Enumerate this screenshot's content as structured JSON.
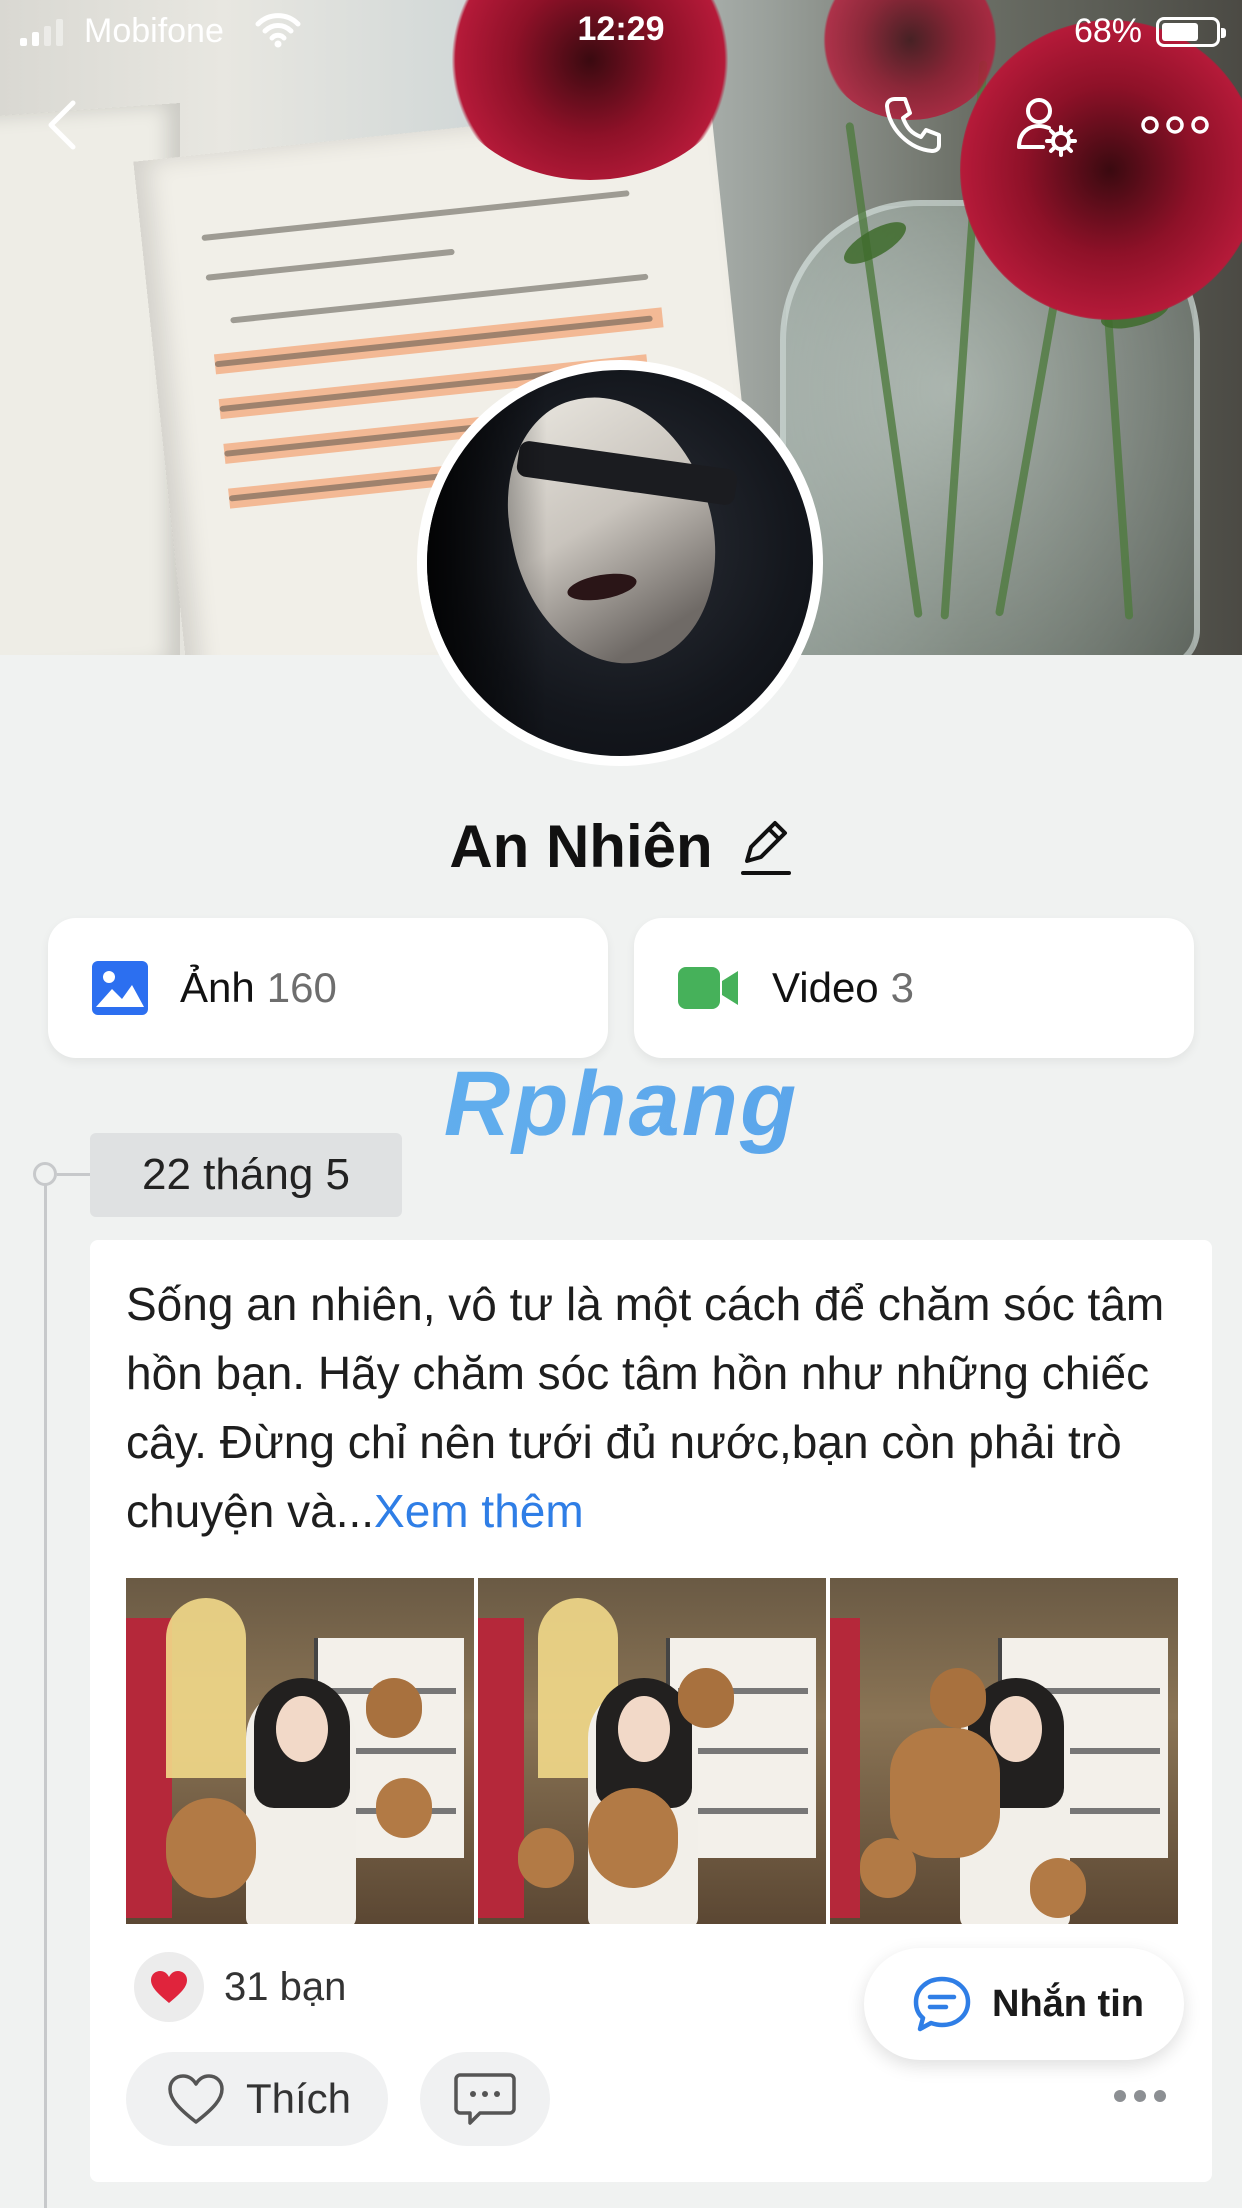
{
  "status_bar": {
    "carrier": "Mobifone",
    "time": "12:29",
    "battery": "68%"
  },
  "profile": {
    "name": "An Nhiên"
  },
  "media": {
    "photos_label": "Ảnh",
    "photos_count": "160",
    "videos_label": "Video",
    "videos_count": "3"
  },
  "watermark": "Rphang",
  "timeline": {
    "date": "22 tháng 5"
  },
  "post": {
    "text": "Sống an nhiên, vô tư là một cách để chăm sóc tâm hồn bạn. Hãy chăm sóc tâm hồn như những chiếc cây. Đừng chỉ nên tưới đủ nước,bạn còn phải trò chuyện và...",
    "see_more": "Xem thêm",
    "reactions": "31 bạn",
    "like_label": "Thích"
  },
  "fab": {
    "label": "Nhắn tin"
  },
  "colors": {
    "accent": "#2f7ee6",
    "photo_icon": "#2c6ff0",
    "video_icon": "#46b15a",
    "heart": "#e0243c"
  },
  "icons": [
    "back-arrow-icon",
    "phone-icon",
    "user-settings-icon",
    "more-options-icon",
    "edit-pencil-icon",
    "photo-icon",
    "video-camera-icon",
    "heart-icon",
    "comment-icon",
    "message-bubble-icon"
  ]
}
